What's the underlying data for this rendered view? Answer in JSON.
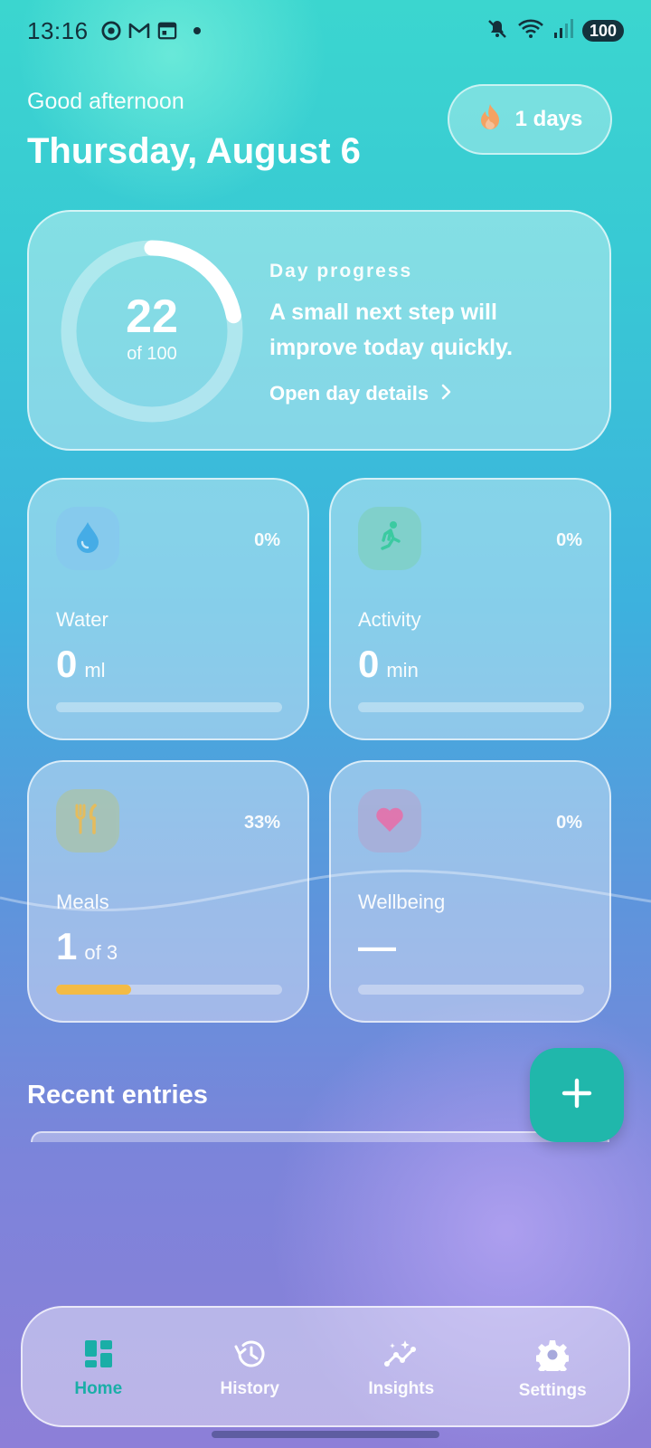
{
  "status_bar": {
    "time": "13:16",
    "battery": "100",
    "left_icons": [
      "chrome-icon",
      "gmail-icon",
      "calendar-app-icon",
      "notification-dot"
    ],
    "right_icons": [
      "mute-icon",
      "wifi-icon",
      "signal-icon",
      "battery-icon"
    ]
  },
  "header": {
    "greeting": "Good afternoon",
    "date": "Thursday, August 6",
    "streak": "1 days"
  },
  "day_progress": {
    "value": "22",
    "of_label": "of 100",
    "progress_fraction": 0.22,
    "eyebrow": "Day progress",
    "message": "A small next step will improve today quickly.",
    "link": "Open day details"
  },
  "metrics": {
    "water": {
      "label": "Water",
      "value": "0",
      "unit": "ml",
      "percent": "0%",
      "fraction": 0,
      "icon": "water-drop-icon",
      "icon_color": "#3aa6e6",
      "icon_bg": "#86c9ee"
    },
    "activity": {
      "label": "Activity",
      "value": "0",
      "unit": "min",
      "percent": "0%",
      "fraction": 0,
      "icon": "running-person-icon",
      "icon_color": "#2ec995",
      "icon_bg": "#7fd0c6"
    },
    "meals": {
      "label": "Meals",
      "value": "1",
      "unit": "of 3",
      "percent": "33%",
      "fraction": 0.33,
      "icon": "cutlery-icon",
      "icon_color": "#f3bb45",
      "icon_bg": "#a8c3b0"
    },
    "wellbeing": {
      "label": "Wellbeing",
      "value": "—",
      "unit": "",
      "percent": "0%",
      "fraction": 0,
      "icon": "heart-icon",
      "icon_color": "#ec6aa5",
      "icon_bg": "#a9aed8"
    }
  },
  "recent": {
    "title": "Recent entries"
  },
  "fab": {
    "icon": "plus-icon",
    "color": "#20b7ab"
  },
  "nav": {
    "items": [
      {
        "label": "Home",
        "icon": "dashboard-icon",
        "active": true
      },
      {
        "label": "History",
        "icon": "history-icon",
        "active": false
      },
      {
        "label": "Insights",
        "icon": "insights-icon",
        "active": false
      },
      {
        "label": "Settings",
        "icon": "gear-icon",
        "active": false
      }
    ],
    "active_color": "#1aaea7"
  }
}
